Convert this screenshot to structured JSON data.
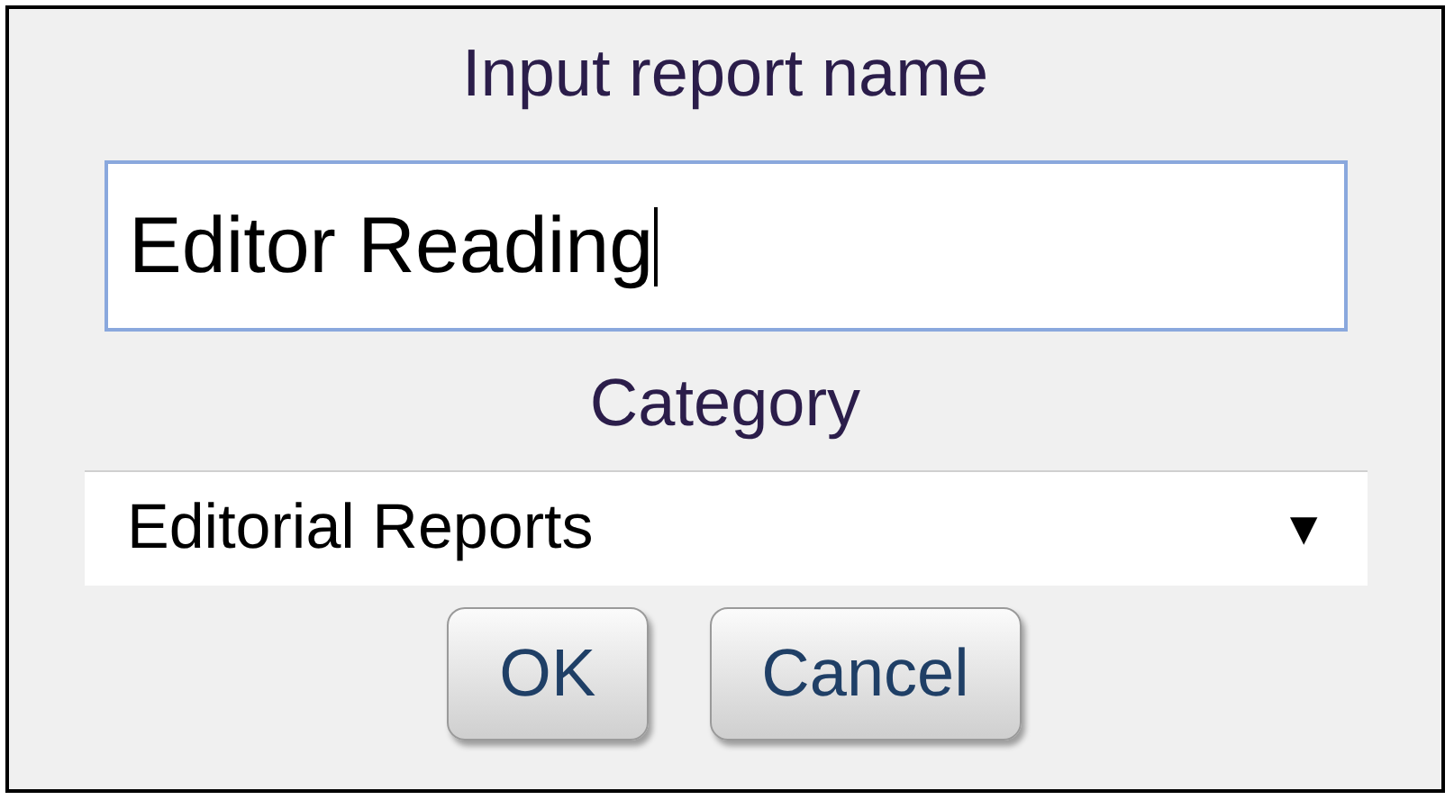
{
  "dialog": {
    "title": "Input report name",
    "name_field": {
      "value": "Editor Reading"
    },
    "category_label": "Category",
    "category_select": {
      "value": "Editorial Reports",
      "arrow": "▼"
    },
    "buttons": [
      {
        "label": "OK"
      },
      {
        "label": "Cancel"
      }
    ]
  }
}
